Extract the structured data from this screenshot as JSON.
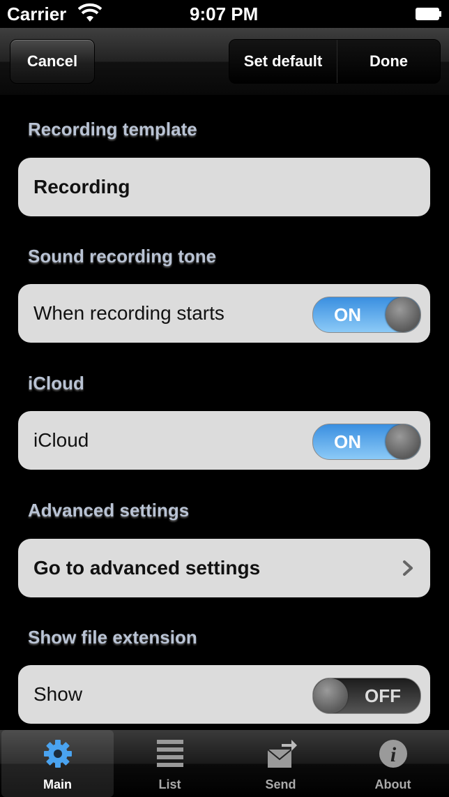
{
  "status_bar": {
    "carrier": "Carrier",
    "time": "9:07 PM"
  },
  "nav": {
    "cancel": "Cancel",
    "set_default": "Set default",
    "done": "Done"
  },
  "sections": {
    "recording_template": {
      "header": "Recording template",
      "value": "Recording"
    },
    "sound_tone": {
      "header": "Sound recording tone",
      "label": "When recording starts",
      "toggle": "ON"
    },
    "icloud": {
      "header": "iCloud",
      "label": "iCloud",
      "toggle": "ON"
    },
    "advanced": {
      "header": "Advanced settings",
      "label": "Go to advanced settings"
    },
    "file_ext": {
      "header": "Show file extension",
      "label": "Show",
      "toggle": "OFF"
    }
  },
  "tabs": [
    {
      "label": "Main",
      "icon": "gear-icon"
    },
    {
      "label": "List",
      "icon": "list-icon"
    },
    {
      "label": "Send",
      "icon": "send-icon"
    },
    {
      "label": "About",
      "icon": "info-icon"
    }
  ],
  "colors": {
    "toggle_on": "#3a8fe0",
    "section_header": "#b9c3d4",
    "tab_active_icon": "#4aa3f0"
  }
}
